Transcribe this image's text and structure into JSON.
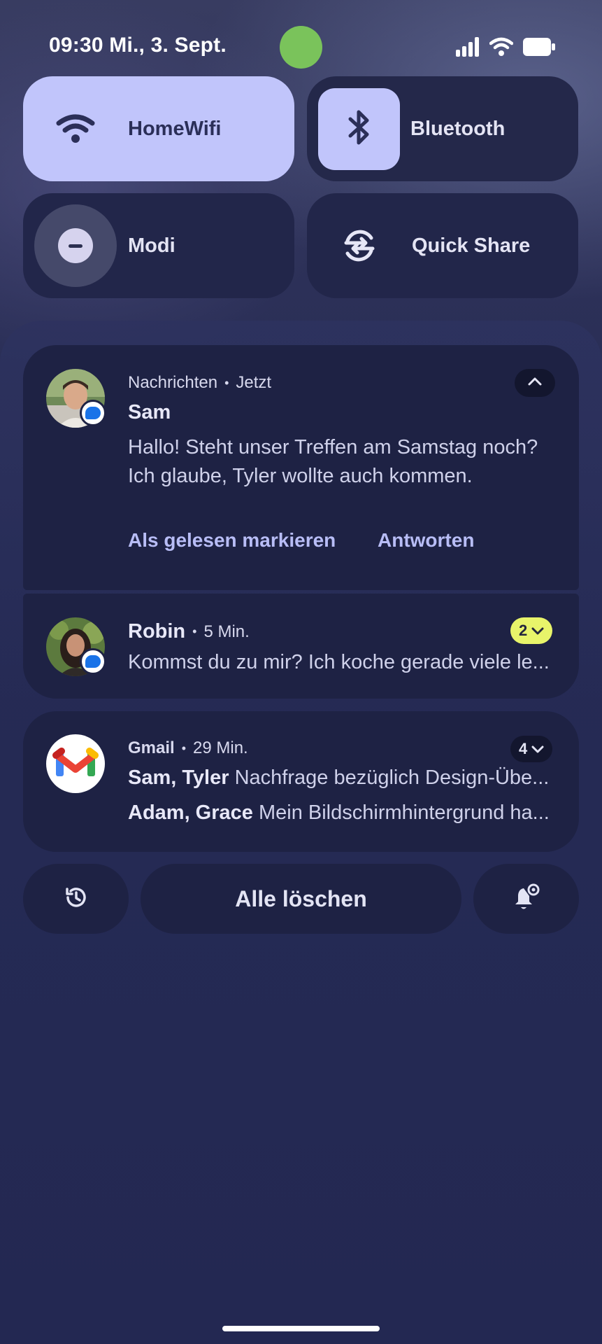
{
  "status_bar": {
    "time_date": "09:30 Mi., 3. Sept.",
    "camera_indicator_color": "#7ac35b",
    "icons": [
      "signal-icon",
      "wifi-icon",
      "battery-icon"
    ]
  },
  "quick_settings": {
    "tiles": [
      {
        "label": "HomeWifi",
        "icon": "wifi-icon",
        "active": true
      },
      {
        "label": "Bluetooth",
        "icon": "bluetooth-icon",
        "active": true
      },
      {
        "label": "Modi",
        "icon": "do-not-disturb-icon",
        "active": false
      },
      {
        "label": "Quick Share",
        "icon": "quick-share-icon",
        "active": false
      }
    ]
  },
  "notifications": {
    "sam": {
      "app": "Nachrichten",
      "time": "Jetzt",
      "sender": "Sam",
      "body_line1": "Hallo! Steht unser Treffen am Samstag noch?",
      "body_line2": "Ich glaube, Tyler wollte auch kommen.",
      "action_mark_read": "Als gelesen markieren",
      "action_reply": "Antworten"
    },
    "robin": {
      "sender": "Robin",
      "time": "5 Min.",
      "preview": "Kommst du zu mir? Ich koche gerade viele le...",
      "count": "2"
    },
    "gmail": {
      "app": "Gmail",
      "time": "29 Min.",
      "count": "4",
      "threads": [
        {
          "senders": "Sam, Tyler",
          "subject": "Nachfrage bezüglich Design-Übe..."
        },
        {
          "senders": "Adam, Grace",
          "subject": "Mein Bildschirmhintergrund ha..."
        }
      ]
    }
  },
  "bottom_actions": {
    "clear_all": "Alle löschen"
  },
  "colors": {
    "accent_tile": "#c1c5fb",
    "card_bg": "#1e2244",
    "action_text": "#b8bdf6",
    "badge_yellow": "#e8f46a"
  }
}
